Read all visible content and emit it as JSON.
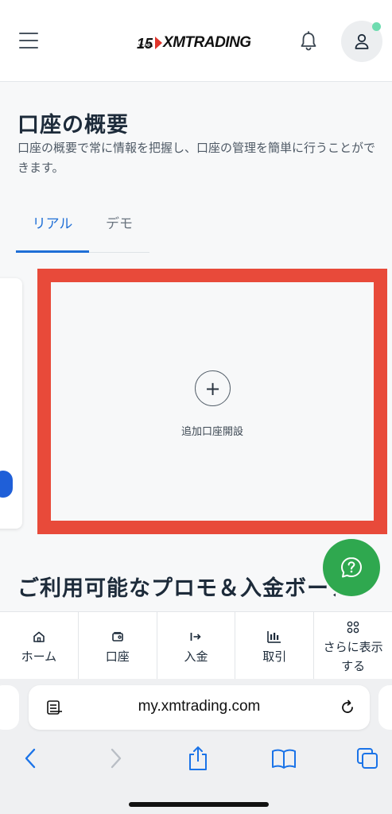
{
  "header": {
    "logo_number": "15",
    "logo_years": "YEARS",
    "logo_brand": "XMTRADING",
    "icons": [
      "hamburger-icon",
      "bell-icon",
      "user-icon"
    ]
  },
  "overview": {
    "title": "口座の概要",
    "description": "口座の概要で常に情報を把握し、口座の管理を簡単に行うことができます。"
  },
  "tabs": [
    {
      "label": "リアル",
      "active": true
    },
    {
      "label": "デモ",
      "active": false
    }
  ],
  "add_account": {
    "icon": "plus-icon",
    "label": "追加口座開設"
  },
  "promo": {
    "title": "ご利用可能なプロモ＆入金ボーナス"
  },
  "bottom_nav": [
    {
      "label": "ホーム",
      "icon": "home-icon"
    },
    {
      "label": "口座",
      "icon": "wallet-icon"
    },
    {
      "label": "入金",
      "icon": "deposit-icon"
    },
    {
      "label": "取引",
      "icon": "chart-icon"
    },
    {
      "label": "さらに表示する",
      "icon": "grid-icon"
    }
  ],
  "browser": {
    "url": "my.xmtrading.com",
    "icons": [
      "back-icon",
      "forward-icon",
      "share-icon",
      "bookmarks-icon",
      "tabs-icon"
    ]
  },
  "colors": {
    "accent_blue": "#1f6fd6",
    "highlight_red": "#e84a3a",
    "help_green": "#2fa84f"
  }
}
